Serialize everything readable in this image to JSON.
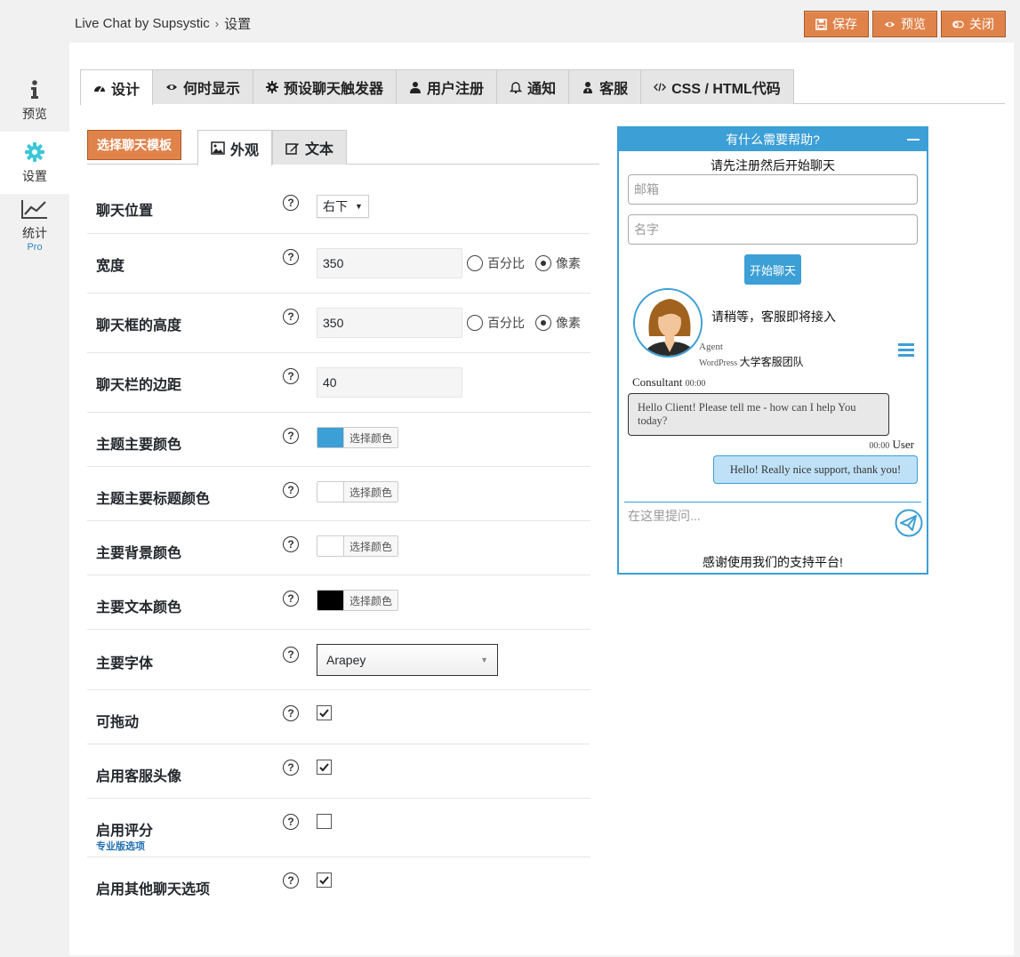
{
  "breadcrumb": {
    "plugin": "Live Chat by Supsystic",
    "sep": "›",
    "page": "设置"
  },
  "actions": {
    "save": "保存",
    "preview": "预览",
    "close": "关闭"
  },
  "nav": [
    {
      "label": "预览",
      "icon": "info-icon"
    },
    {
      "label": "设置",
      "icon": "gear-icon"
    },
    {
      "label": "统计",
      "icon": "chart-icon",
      "badge": "Pro"
    }
  ],
  "tabs": [
    "设计",
    "何时显示",
    "预设聊天触发器",
    "用户注册",
    "通知",
    "客服",
    "CSS / HTML代码"
  ],
  "subbar": {
    "template_btn": "选择聊天模板",
    "tab_look": "外观",
    "tab_text": "文本"
  },
  "form": {
    "position": {
      "label": "聊天位置",
      "value": "右下"
    },
    "width": {
      "label": "宽度",
      "value": "350",
      "opt1": "百分比",
      "opt2": "像素"
    },
    "height": {
      "label": "聊天框的高度",
      "value": "350",
      "opt1": "百分比",
      "opt2": "像素"
    },
    "margin": {
      "label": "聊天栏的边距",
      "value": "40"
    },
    "color_main": {
      "label": "主题主要颜色",
      "btn": "选择颜色",
      "color": "#3c9fd6"
    },
    "color_title": {
      "label": "主题主要标题颜色",
      "btn": "选择颜色",
      "color": "#ffffff"
    },
    "color_bg": {
      "label": "主要背景颜色",
      "btn": "选择颜色",
      "color": "#ffffff"
    },
    "color_text": {
      "label": "主要文本颜色",
      "btn": "选择颜色",
      "color": "#000000"
    },
    "font": {
      "label": "主要字体",
      "value": "Arapey"
    },
    "draggable": {
      "label": "可拖动",
      "checked": true
    },
    "avatar": {
      "label": "启用客服头像",
      "checked": true
    },
    "rating": {
      "label": "启用评分",
      "sublabel": "专业版选项",
      "checked": false
    },
    "other": {
      "label": "启用其他聊天选项",
      "checked": true
    },
    "help": "?"
  },
  "preview": {
    "header": "有什么需要帮助?",
    "title": "请先注册然后开始聊天",
    "email_ph": "邮箱",
    "name_ph": "名字",
    "start": "开始聊天",
    "wait": "请稍等，客服即将接入",
    "agent": "Agent",
    "team_prefix": "WordPress",
    "team": "大学客服团队",
    "consultant": "Consultant",
    "consultant_time": "00:00",
    "msg1": "Hello Client! Please tell me - how can I help You today?",
    "user_time": "00:00",
    "user": "User",
    "msg2": "Hello! Really nice support, thank you!",
    "ask_ph": "在这里提问...",
    "thanks": "感谢使用我们的支持平台!"
  }
}
